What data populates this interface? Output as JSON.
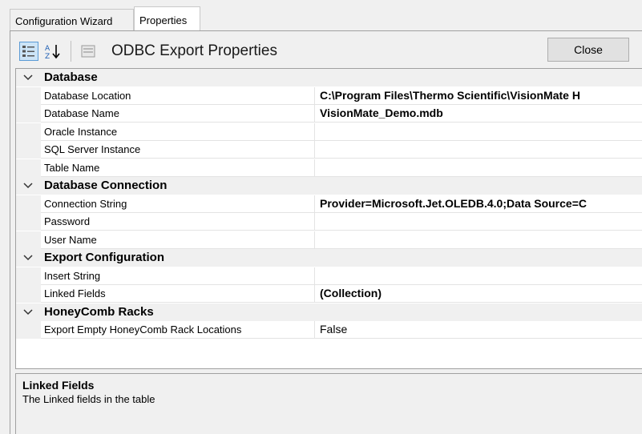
{
  "tabs": [
    {
      "label": "Configuration Wizard"
    },
    {
      "label": "Properties"
    }
  ],
  "toolbar": {
    "title": "ODBC Export Properties",
    "close_label": "Close",
    "icons": [
      "categorized-icon",
      "alphabetical-sort-icon",
      "property-pages-icon"
    ]
  },
  "grid": {
    "categories": [
      {
        "label": "Database",
        "rows": [
          {
            "name": "Database Location",
            "value": "C:\\Program Files\\Thermo Scientific\\VisionMate H",
            "bold": true
          },
          {
            "name": "Database Name",
            "value": "VisionMate_Demo.mdb",
            "bold": true
          },
          {
            "name": "Oracle Instance",
            "value": "",
            "bold": false
          },
          {
            "name": "SQL Server Instance",
            "value": "",
            "bold": false
          },
          {
            "name": "Table Name",
            "value": "",
            "bold": false
          }
        ]
      },
      {
        "label": "Database Connection",
        "rows": [
          {
            "name": "Connection String",
            "value": "Provider=Microsoft.Jet.OLEDB.4.0;Data Source=C",
            "bold": true
          },
          {
            "name": "Password",
            "value": "",
            "bold": false
          },
          {
            "name": "User Name",
            "value": "",
            "bold": false
          }
        ]
      },
      {
        "label": "Export Configuration",
        "rows": [
          {
            "name": "Insert String",
            "value": "",
            "bold": false
          },
          {
            "name": "Linked Fields",
            "value": "(Collection)",
            "bold": true
          }
        ]
      },
      {
        "label": "HoneyComb Racks",
        "rows": [
          {
            "name": "Export Empty HoneyComb Rack Locations",
            "value": "False",
            "bold": false
          }
        ]
      }
    ]
  },
  "description": {
    "title": "Linked Fields",
    "text": "The Linked fields in the table"
  }
}
